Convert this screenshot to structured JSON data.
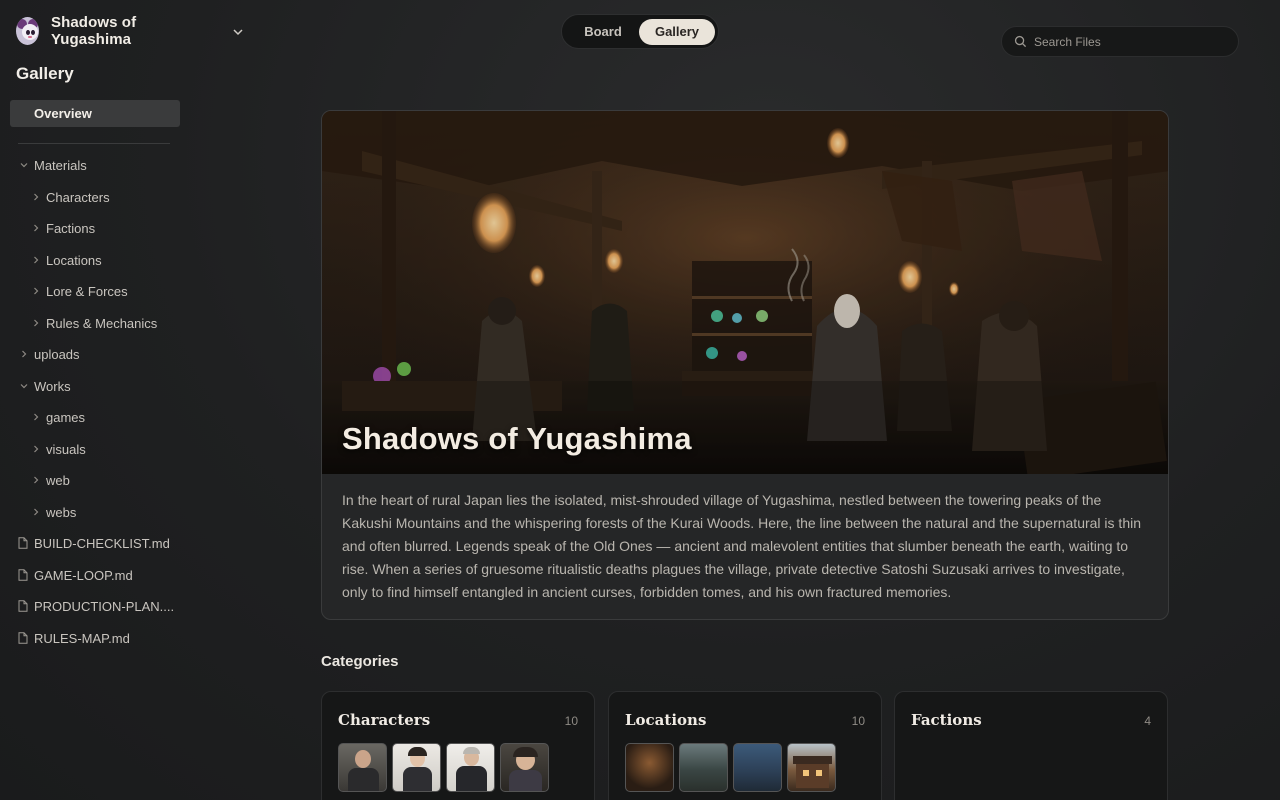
{
  "project": {
    "name": "Shadows of Yugashima",
    "logo_icon": "anime-girl-avatar",
    "dropdown_icon": "chevron-down-icon"
  },
  "sidebar": {
    "title": "Gallery",
    "overview_label": "Overview",
    "tree": [
      {
        "label": "Materials",
        "type": "folder",
        "expanded": true
      },
      {
        "label": "Characters",
        "type": "folder",
        "expanded": false
      },
      {
        "label": "Factions",
        "type": "folder",
        "expanded": false
      },
      {
        "label": "Locations",
        "type": "folder",
        "expanded": false
      },
      {
        "label": "Lore & Forces",
        "type": "folder",
        "expanded": false
      },
      {
        "label": "Rules & Mechanics",
        "type": "folder",
        "expanded": false
      },
      {
        "label": "uploads",
        "type": "folder",
        "expanded": false
      },
      {
        "label": "Works",
        "type": "folder",
        "expanded": true
      },
      {
        "label": "games",
        "type": "folder",
        "expanded": false
      },
      {
        "label": "visuals",
        "type": "folder",
        "expanded": false
      },
      {
        "label": "web",
        "type": "folder",
        "expanded": false
      },
      {
        "label": "webs",
        "type": "folder",
        "expanded": false
      },
      {
        "label": "BUILD-CHECKLIST.md",
        "type": "file"
      },
      {
        "label": "GAME-LOOP.md",
        "type": "file"
      },
      {
        "label": "PRODUCTION-PLAN....",
        "type": "file"
      },
      {
        "label": "RULES-MAP.md",
        "type": "file"
      }
    ]
  },
  "view_toggle": {
    "board_label": "Board",
    "gallery_label": "Gallery",
    "active": "Gallery"
  },
  "search": {
    "placeholder": "Search Files",
    "value": ""
  },
  "hero": {
    "title": "Shadows of Yugashima",
    "description": "In the heart of rural Japan lies the isolated, mist-shrouded village of Yugashima, nestled between the towering peaks of the Kakushi Mountains and the whispering forests of the Kurai Woods. Here, the line between the natural and the supernatural is thin and often blurred. Legends speak of the Old Ones — ancient and malevolent entities that slumber beneath the earth, waiting to rise. When a series of gruesome ritualistic deaths plagues the village, private detective Satoshi Suzusaki arrives to investigate, only to find himself entangled in ancient curses, forbidden tomes, and his own fractured memories."
  },
  "categories": {
    "title": "Categories",
    "cards": [
      {
        "name": "Characters",
        "count": "10",
        "thumbs": [
          "character-portrait-1",
          "character-portrait-2",
          "character-portrait-3",
          "character-portrait-4"
        ]
      },
      {
        "name": "Locations",
        "count": "10",
        "thumbs": [
          "location-image-1",
          "location-image-2",
          "location-image-3",
          "location-image-4"
        ]
      },
      {
        "name": "Factions",
        "count": "4",
        "thumbs": []
      }
    ]
  },
  "colors": {
    "background": "#1f2021",
    "accent_toggle": "#eae4da",
    "panel": "#252627"
  }
}
